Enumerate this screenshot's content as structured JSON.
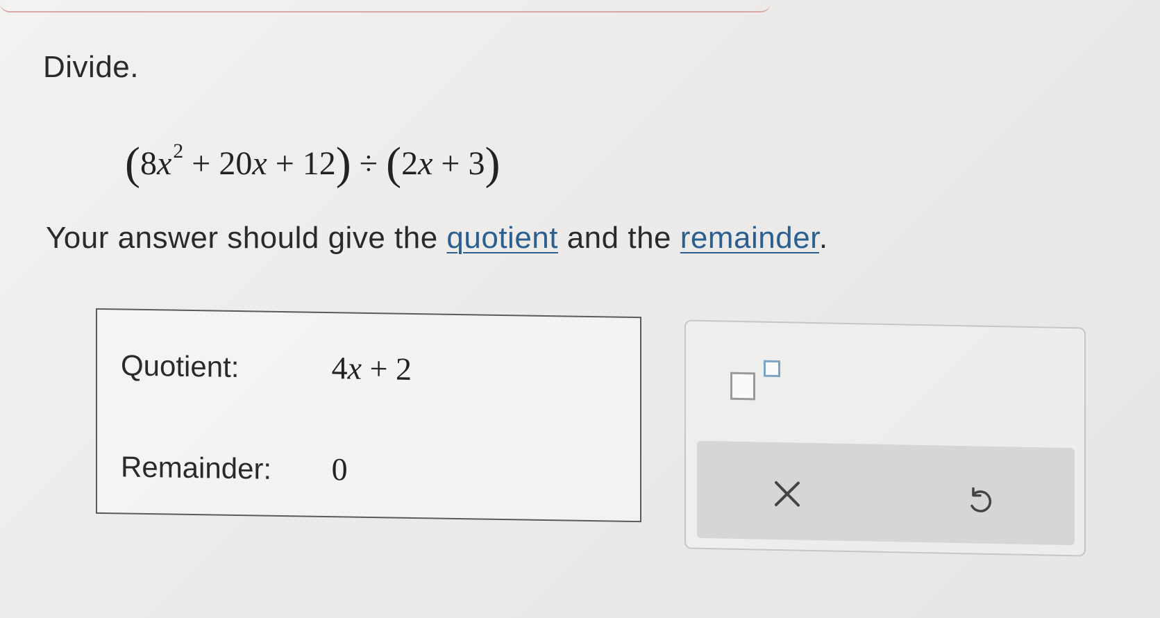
{
  "problem": {
    "instruction": "Divide.",
    "expression": {
      "dividend": {
        "coef1": "8",
        "var": "x",
        "exponent": "2",
        "plus1": "+",
        "coef2": "20",
        "plus2": "+",
        "const": "12"
      },
      "divide_sign": "÷",
      "divisor": {
        "coef": "2",
        "var": "x",
        "plus": "+",
        "const": "3"
      }
    },
    "prompt": {
      "text_before": "Your answer should give the ",
      "quotient_link": "quotient",
      "text_middle": " and the ",
      "remainder_link": "remainder",
      "text_after": "."
    }
  },
  "answer": {
    "quotient_label": "Quotient:",
    "quotient_value": {
      "coef": "4",
      "var": "x",
      "op": "+",
      "const": "2"
    },
    "remainder_label": "Remainder:",
    "remainder_value": "0"
  },
  "tools": {
    "exponent_icon": "exponent-template-icon",
    "clear_icon": "close-icon",
    "undo_icon": "undo-icon",
    "colors": {
      "link": "#2a5f8f",
      "exponent_box": "#7aa3c4",
      "icon_stroke": "#444444",
      "action_bar": "#d6d6d5"
    }
  }
}
